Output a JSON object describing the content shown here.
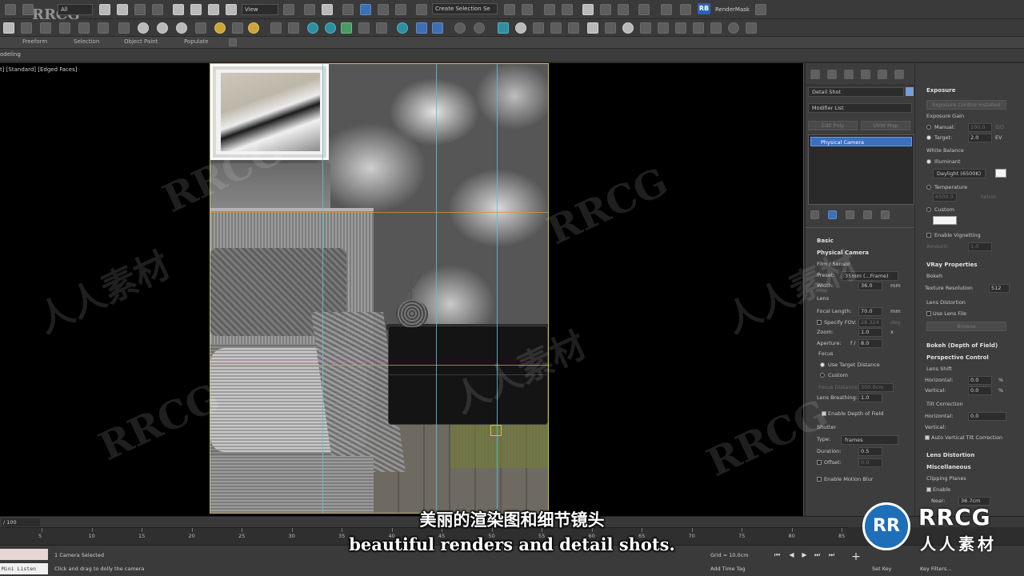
{
  "toolbar": {
    "view_dropdown": "View",
    "selection_set_dropdown": "Create Selection Se",
    "rb_badge": "RB",
    "render_mask": "RenderMask"
  },
  "ribbon": {
    "tabs": [
      "Freeform",
      "Selection",
      "Object Paint",
      "Populate"
    ],
    "modeling_label": "odeling"
  },
  "viewport": {
    "label": "t] [Standard] [Edged Faces]"
  },
  "modify_panel": {
    "object_name": "Detail Shot",
    "modifier_list": "Modifier List",
    "edit_poly_btn": "Edit Poly",
    "uvw_map_btn": "UVW Map",
    "stack_item": "Physical Camera",
    "rollouts": {
      "basic": "Basic",
      "physical_camera": "Physical Camera"
    },
    "film_sensor": "Film / Sensor",
    "preset_label": "Preset:",
    "preset_value": "35mm (...Frame)",
    "width_label": "Width:",
    "width_value": "36.0",
    "width_unit": "mm",
    "lens": "Lens",
    "focal_length_label": "Focal Length:",
    "focal_length_value": "70.0",
    "focal_length_unit": "mm",
    "specify_fov_label": "Specify FOV:",
    "specify_fov_value": "28.324",
    "specify_fov_unit": "deg",
    "zoom_label": "Zoom:",
    "zoom_value": "1.0",
    "zoom_unit": "x",
    "aperture_label": "Aperture:",
    "aperture_f": "f /",
    "aperture_value": "8.0",
    "focus": "Focus",
    "use_target_distance": "Use Target Distance",
    "custom": "Custom",
    "focus_distance_label": "Focus Distance:",
    "focus_distance_value": "300.0cm",
    "lens_breathing_label": "Lens Breathing:",
    "lens_breathing_value": "1.0",
    "enable_dof": "Enable Depth of Field",
    "shutter": "Shutter",
    "type_label": "Type:",
    "type_value": "frames",
    "duration_label": "Duration:",
    "duration_value": "0.5",
    "offset_label": "Offset:",
    "offset_value": "0.0",
    "enable_motion_blur": "Enable Motion Blur"
  },
  "right_panel": {
    "exposure": "Exposure",
    "exposure_control_btn": "Exposure Control Installed",
    "exposure_gain": "Exposure Gain",
    "manual_label": "Manual:",
    "manual_value": "100.0",
    "manual_unit": "ISO",
    "target_label": "Target:",
    "target_value": "2.0",
    "target_unit": "EV",
    "white_balance": "White Balance",
    "illuminant": "Illuminant",
    "illuminant_value": "Daylight (6500K)",
    "temperature": "Temperature",
    "temperature_value": "6500.0",
    "temperature_unit": "kelvin",
    "custom": "Custom",
    "enable_vignetting": "Enable Vignetting",
    "amount_label": "Amount:",
    "amount_value": "1.0",
    "vray_properties": "VRay Properties",
    "bokeh": "Bokeh",
    "texture_resolution_label": "Texture Resolution",
    "texture_resolution_value": "512",
    "lens_distortion": "Lens Distortion",
    "use_lens_file": "Use Lens File",
    "browse_btn": "Browse",
    "bokeh_dof": "Bokeh (Depth of Field)",
    "perspective_control": "Perspective Control",
    "lens_shift": "Lens Shift",
    "horizontal_label": "Horizontal:",
    "horizontal_value": "0.0",
    "vertical_label": "Vertical:",
    "vertical_value": "0.0",
    "percent": "%",
    "tilt_correction": "Tilt Correction",
    "tilt_horizontal_value": "0.0",
    "auto_vertical_tilt": "Auto Vertical Tilt Correction",
    "lens_distortion2": "Lens Distortion",
    "miscellaneous": "Miscellaneous",
    "clipping_planes": "Clipping Planes",
    "enable": "Enable",
    "near_label": "Near:",
    "near_value": "36.7cm"
  },
  "timeline": {
    "frame_label": "/ 100",
    "ticks": [
      "5",
      "10",
      "15",
      "20",
      "25",
      "30",
      "35",
      "40",
      "45",
      "50",
      "55",
      "60",
      "65",
      "70",
      "75",
      "80",
      "85"
    ]
  },
  "status": {
    "maxscript": "Mini Listen",
    "selected": "1 Camera Selected",
    "prompt": "Click and drag to dolly the camera",
    "grid": "Grid = 10.0cm",
    "add_time_tag": "Add Time Tag",
    "set_key": "Set Key",
    "key_filters": "Key Filters..."
  },
  "subtitles": {
    "cn": "美丽的渲染图和细节镜头",
    "en": "beautiful renders and detail shots."
  },
  "watermark": {
    "logo_main": "RRCG",
    "logo_sub": "人人素材",
    "logo_badge": "RR",
    "tile_en": "RRCG",
    "tile_cn": "人人素材"
  },
  "colors": {
    "accent_blue": "#3a6fc0",
    "safe_frame": "#c8bc3c",
    "guide_line": "#5bc0d8"
  }
}
